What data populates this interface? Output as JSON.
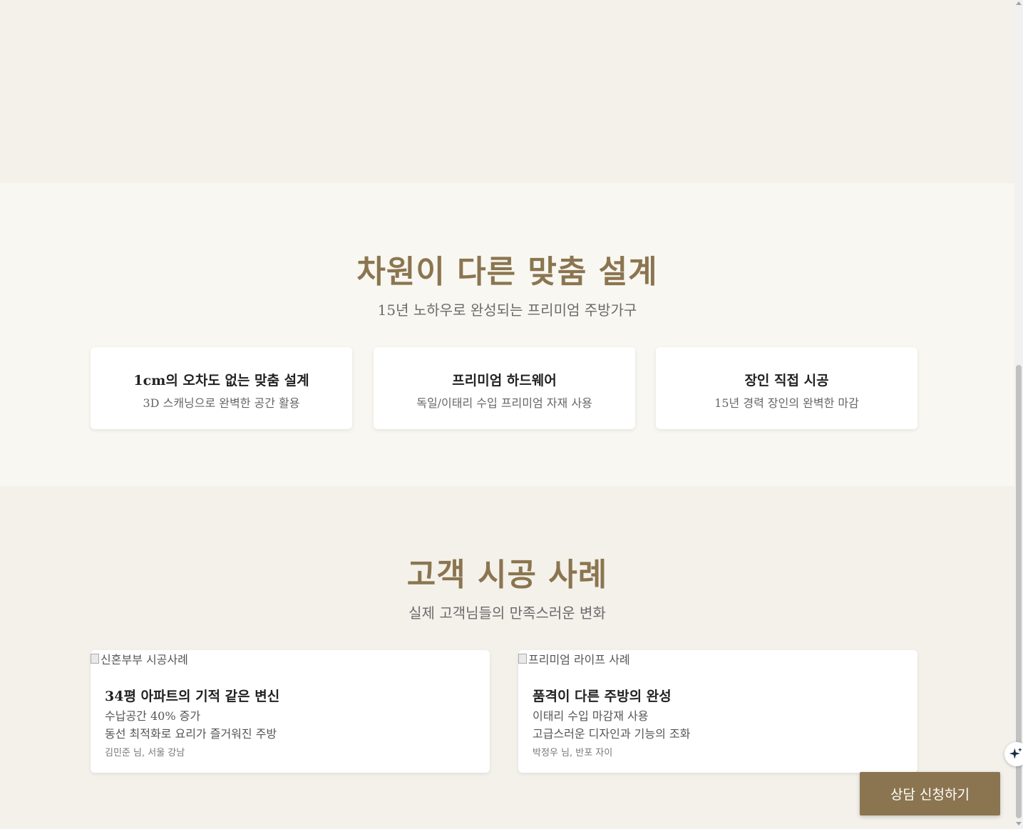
{
  "features": {
    "title": "차원이 다른 맞춤 설계",
    "subtitle": "15년 노하우로 완성되는 프리미엄 주방가구",
    "cards": [
      {
        "title": "1cm의 오차도 없는 맞춤 설계",
        "desc": "3D 스캐닝으로 완벽한 공간 활용"
      },
      {
        "title": "프리미엄 하드웨어",
        "desc": "독일/이태리 수입 프리미엄 자재 사용"
      },
      {
        "title": "장인 직접 시공",
        "desc": "15년 경력 장인의 완벽한 마감"
      }
    ]
  },
  "cases": {
    "title": "고객 시공 사례",
    "subtitle": "실제 고객님들의 만족스러운 변화",
    "items": [
      {
        "image_alt": "신혼부부 시공사례",
        "title": "34평 아파트의 기적 같은 변신",
        "line1": "수납공간 40% 증가",
        "line2": "동선 최적화로 요리가 즐거워진 주방",
        "author": "김민준 님, 서울 강남"
      },
      {
        "image_alt": "프리미엄 라이프 사례",
        "title": "품격이 다른 주방의 완성",
        "line1": "이태리 수입 마감재 사용",
        "line2": "고급스러운 디자인과 기능의 조화",
        "author": "박정우 님, 반포 자이"
      }
    ]
  },
  "cta": {
    "label": "상담 신청하기"
  },
  "colors": {
    "accent": "#8b7550",
    "bg": "#f3f1ea",
    "bg_alt": "#f8f7f1"
  },
  "icons": {
    "assistant": "sparkle-icon"
  }
}
